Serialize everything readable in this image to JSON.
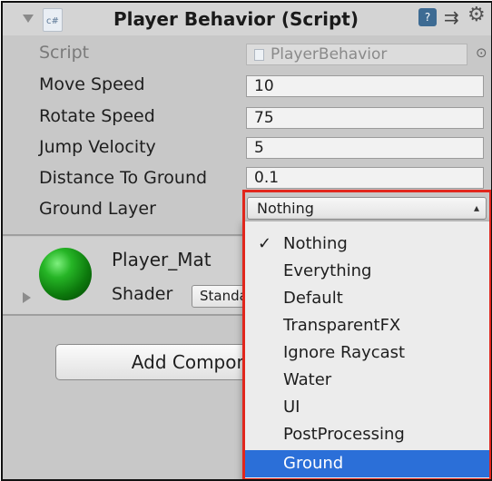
{
  "header": {
    "script_icon_text": "c#",
    "title": "Player Behavior (Script)",
    "help_icon_text": "?",
    "icons": [
      "foldout-arrow-icon",
      "csharp-script-icon",
      "help-icon",
      "preset-icon",
      "gear-icon"
    ]
  },
  "properties": {
    "script_label": "Script",
    "script_value": "PlayerBehavior",
    "move_speed_label": "Move Speed",
    "move_speed_value": "10",
    "rotate_speed_label": "Rotate Speed",
    "rotate_speed_value": "75",
    "jump_velocity_label": "Jump Velocity",
    "jump_velocity_value": "5",
    "distance_label": "Distance To Ground",
    "distance_value": "0.1",
    "ground_layer_label": "Ground Layer",
    "ground_layer_value": "Nothing"
  },
  "material": {
    "name": "Player_Mat",
    "shader_label": "Shader",
    "shader_value": "Standard",
    "sphere_color": "#1e9e1e"
  },
  "add_component_label": "Add Component",
  "menu": {
    "items": [
      {
        "label": "Nothing",
        "checked": true,
        "highlighted": false
      },
      {
        "label": "Everything",
        "checked": false,
        "highlighted": false
      },
      {
        "label": "Default",
        "checked": false,
        "highlighted": false
      },
      {
        "label": "TransparentFX",
        "checked": false,
        "highlighted": false
      },
      {
        "label": "Ignore Raycast",
        "checked": false,
        "highlighted": false
      },
      {
        "label": "Water",
        "checked": false,
        "highlighted": false
      },
      {
        "label": "UI",
        "checked": false,
        "highlighted": false
      },
      {
        "label": "PostProcessing",
        "checked": false,
        "highlighted": false
      },
      {
        "label": "Ground",
        "checked": false,
        "highlighted": true
      }
    ],
    "check_glyph": "✓"
  },
  "colors": {
    "highlight_outline": "#e1261c",
    "selection_blue": "#2b6fd8"
  }
}
